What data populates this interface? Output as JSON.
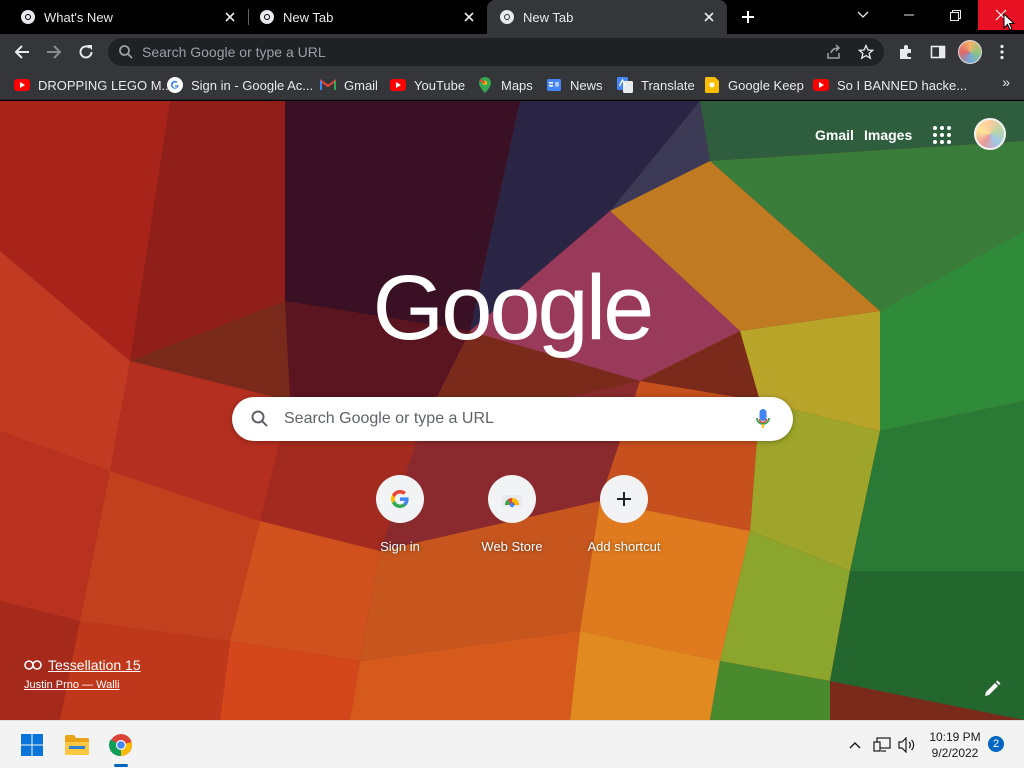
{
  "tabs": [
    {
      "title": "What's New",
      "active": false
    },
    {
      "title": "New Tab",
      "active": false
    },
    {
      "title": "New Tab",
      "active": true
    }
  ],
  "toolbar": {
    "omnibox_placeholder": "Search Google or type a URL"
  },
  "bookmarks": [
    {
      "label": "DROPPING LEGO M...",
      "icon": "youtube-icon"
    },
    {
      "label": "Sign in - Google Ac...",
      "icon": "google-icon"
    },
    {
      "label": "Gmail",
      "icon": "gmail-icon"
    },
    {
      "label": "YouTube",
      "icon": "youtube-icon"
    },
    {
      "label": "Maps",
      "icon": "maps-icon"
    },
    {
      "label": "News",
      "icon": "news-icon"
    },
    {
      "label": "Translate",
      "icon": "translate-icon"
    },
    {
      "label": "Google Keep",
      "icon": "keep-icon"
    },
    {
      "label": "So I BANNED hacke...",
      "icon": "youtube-icon"
    }
  ],
  "ntp": {
    "header_links": [
      "Gmail",
      "Images"
    ],
    "logo_text": "Google",
    "search_placeholder": "Search Google or type a URL",
    "shortcuts": [
      {
        "label": "Sign in",
        "icon": "google-icon"
      },
      {
        "label": "Web Store",
        "icon": "webstore-icon"
      },
      {
        "label": "Add shortcut",
        "icon": "plus-icon"
      }
    ],
    "attribution": {
      "title": "Tessellation 15",
      "author": "Justin Prno — Walli"
    }
  },
  "taskbar": {
    "time": "10:19 PM",
    "date": "9/2/2022",
    "notification_count": "2"
  },
  "colors": {
    "tabstrip_bg": "#000000",
    "toolbar_bg": "#35363a",
    "omnibox_bg": "#202124",
    "close_hover": "#e81123",
    "accent": "#0067c0"
  }
}
